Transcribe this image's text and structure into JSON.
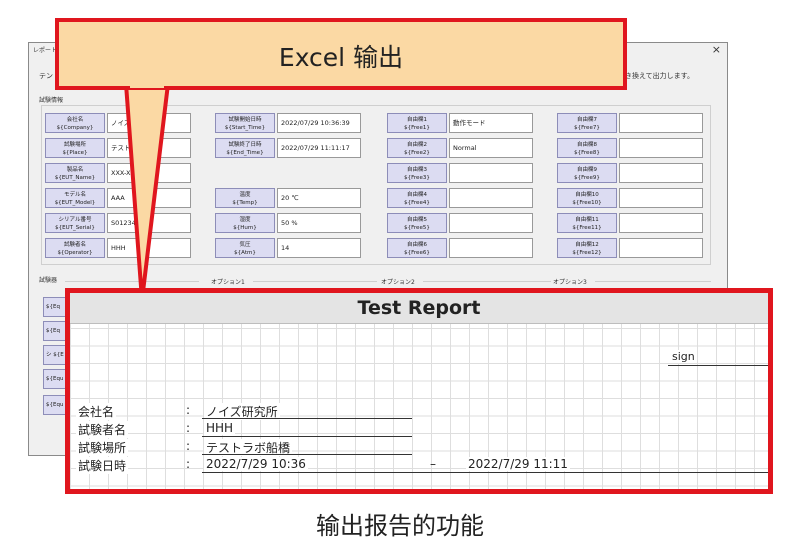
{
  "dialog": {
    "title": "レポート出力",
    "close_glyph": "×",
    "desc_left": "テン",
    "desc_right": "き換えて出力します。",
    "info_group_label": "試験情報",
    "equip_group_label": "試験器",
    "fields": [
      {
        "label": "会社名",
        "var": "${Company}",
        "value": "ノイズ研究所"
      },
      {
        "label": "試験場所",
        "var": "${Place}",
        "value": "テストラボ船"
      },
      {
        "label": "製品名",
        "var": "${EUT_Name}",
        "value": "XXX-XXX"
      },
      {
        "label": "モデル名",
        "var": "${EUT_Model}",
        "value": "AAA"
      },
      {
        "label": "シリアル番号",
        "var": "${EUT_Serial}",
        "value": "S012345"
      },
      {
        "label": "試験者名",
        "var": "${Operator}",
        "value": "HHH"
      },
      {
        "label": "試験開始日時",
        "var": "${Start_Time}",
        "value": "2022/07/29 10:36:39"
      },
      {
        "label": "試験終了日時",
        "var": "${End_Time}",
        "value": "2022/07/29 11:11:17"
      },
      {
        "label": "温度",
        "var": "${Temp}",
        "value": "20 ℃"
      },
      {
        "label": "湿度",
        "var": "${Hum}",
        "value": "50 %"
      },
      {
        "label": "気圧",
        "var": "${Atm}",
        "value": "14"
      },
      {
        "label": "自由欄1",
        "var": "${Free1}",
        "value": "動作モード"
      },
      {
        "label": "自由欄2",
        "var": "${Free2}",
        "value": "Normal"
      },
      {
        "label": "自由欄3",
        "var": "${Free3}",
        "value": ""
      },
      {
        "label": "自由欄4",
        "var": "${Free4}",
        "value": ""
      },
      {
        "label": "自由欄5",
        "var": "${Free5}",
        "value": ""
      },
      {
        "label": "自由欄6",
        "var": "${Free6}",
        "value": ""
      },
      {
        "label": "自由欄7",
        "var": "${Free7}",
        "value": ""
      },
      {
        "label": "自由欄8",
        "var": "${Free8}",
        "value": ""
      },
      {
        "label": "自由欄9",
        "var": "${Free9}",
        "value": ""
      },
      {
        "label": "自由欄10",
        "var": "${Free10}",
        "value": ""
      },
      {
        "label": "自由欄11",
        "var": "${Free11}",
        "value": ""
      },
      {
        "label": "自由欄12",
        "var": "${Free12}",
        "value": ""
      }
    ],
    "options": [
      "オプション1",
      "オプション2",
      "オプション3"
    ],
    "equip_stubs": [
      "${Eq",
      "${Eq",
      "シ ${E",
      "${Equ",
      "${Equ"
    ]
  },
  "callout": {
    "text": "Excel 输出",
    "fill": "#fbd9a4",
    "border": "#e0161e"
  },
  "report": {
    "title": "Test Report",
    "sign_label": "sign",
    "rows": [
      {
        "label": "会社名",
        "colon": ":",
        "value": "ノイズ研究所"
      },
      {
        "label": "試験者名",
        "colon": ":",
        "value": "HHH"
      },
      {
        "label": "試験場所",
        "colon": ":",
        "value": "テストラボ船橋"
      },
      {
        "label": "試験日時",
        "colon": ":",
        "value": "2022/7/29 10:36"
      }
    ],
    "range_sep": "–",
    "end_time": "2022/7/29 11:11"
  },
  "caption": "输出报告的功能"
}
